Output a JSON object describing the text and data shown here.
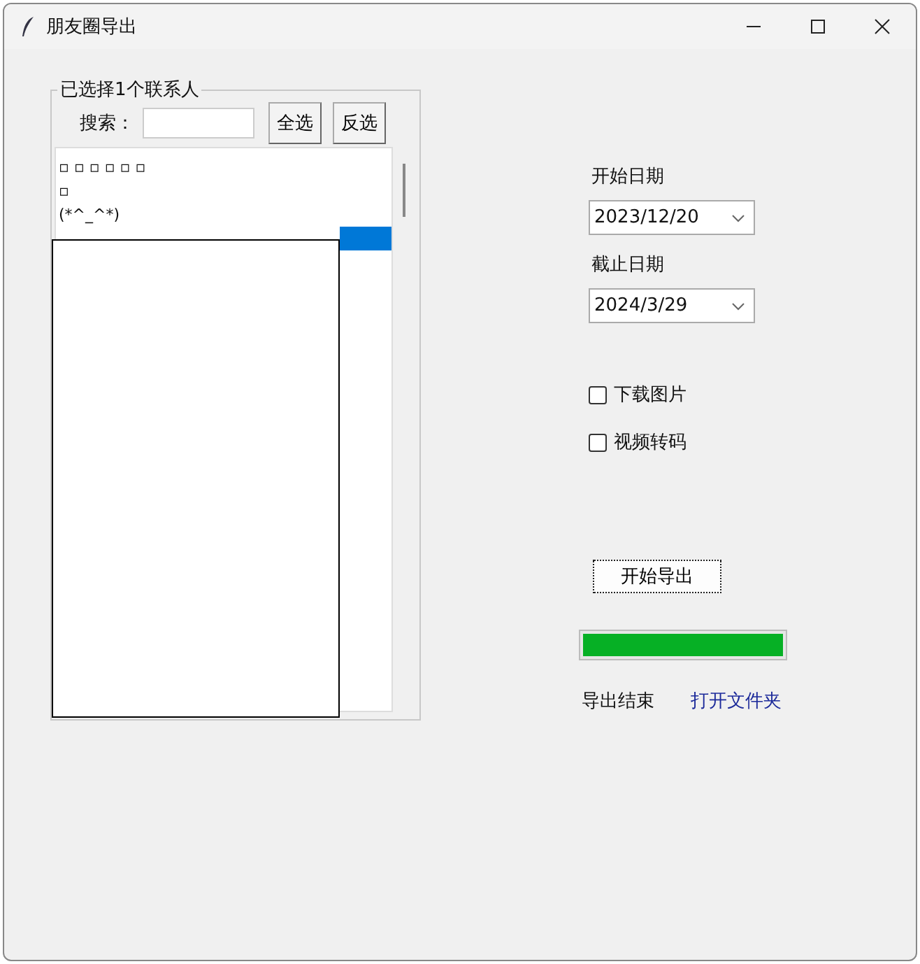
{
  "window": {
    "title": "朋友圈导出"
  },
  "contacts": {
    "legend": "已选择1个联系人",
    "search_label": "搜索：",
    "buttons": [
      "全选",
      "反选"
    ],
    "rows": [
      {
        "label": "▫ ▫ ▫ ▫ ▫ ▫",
        "selected": false
      },
      {
        "label": "▫",
        "selected": false
      },
      {
        "label": "(*^_^*)",
        "selected": false
      },
      {
        "selected": true
      }
    ]
  },
  "start_date": {
    "label": "开始日期",
    "value": "2023/12/20"
  },
  "end_date": {
    "label": "截止日期",
    "value": "2024/3/29"
  },
  "options": [
    {
      "label": "下载图片",
      "checked": false
    },
    {
      "label": "视频转码",
      "checked": false
    }
  ],
  "export_button": "开始导出",
  "progress": {
    "level": 1
  },
  "status": "导出结束",
  "open_folder": "打开文件夹"
}
